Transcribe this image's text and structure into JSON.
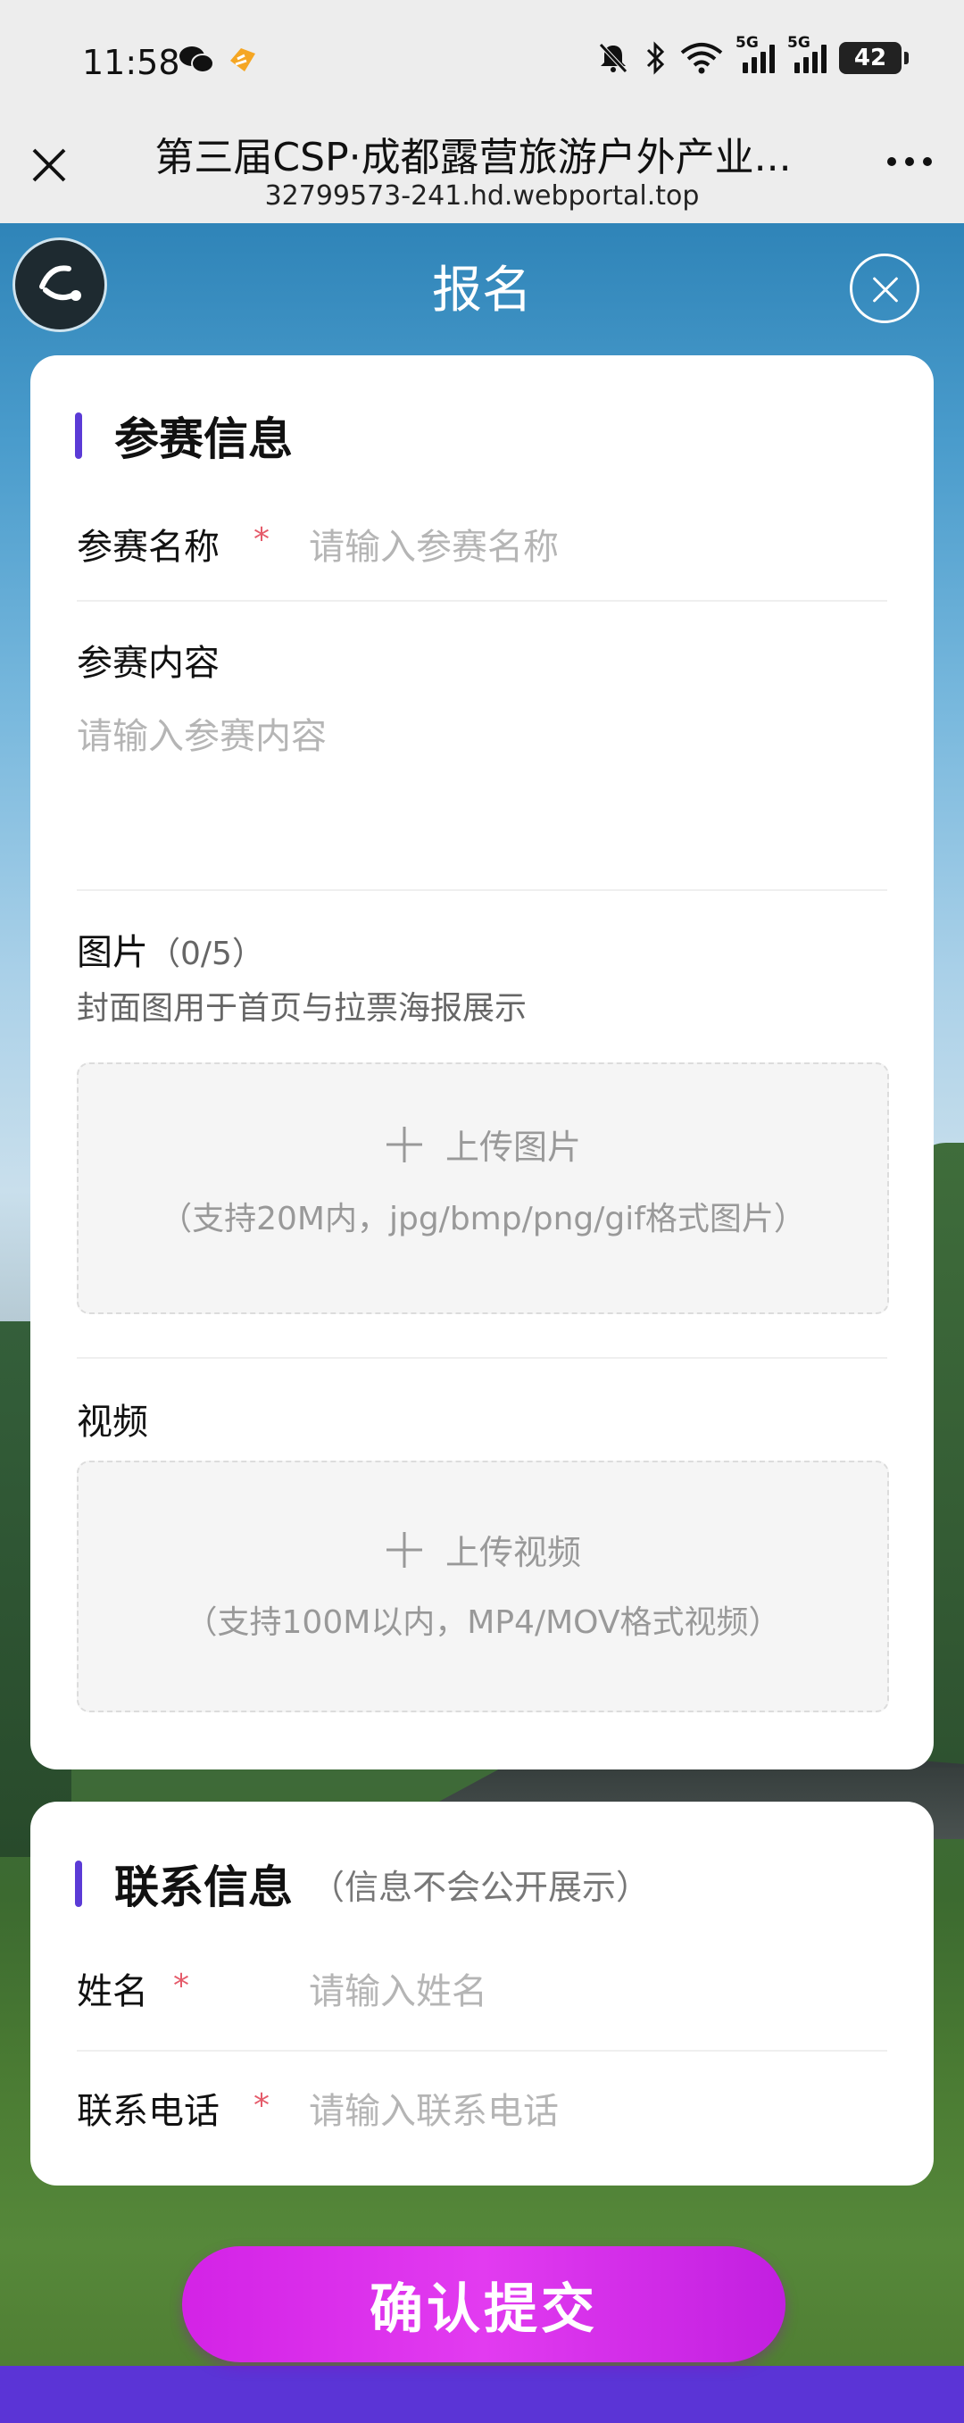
{
  "status_bar": {
    "time": "11:58",
    "battery": "42",
    "network_label": "5G"
  },
  "browser": {
    "title": "第三届CSP·成都露营旅游户外产业...",
    "url": "32799573-241.hd.webportal.top"
  },
  "form": {
    "title": "报名"
  },
  "section_entry": {
    "heading": "参赛信息",
    "name_label": "参赛名称",
    "name_placeholder": "请输入参赛名称",
    "content_label": "参赛内容",
    "content_placeholder": "请输入参赛内容",
    "image_label": "图片",
    "image_count": "（0/5）",
    "image_desc": "封面图用于首页与拉票海报展示",
    "image_upload_label": "上传图片",
    "image_upload_hint": "（支持20M内，jpg/bmp/png/gif格式图片）",
    "video_label": "视频",
    "video_upload_label": "上传视频",
    "video_upload_hint": "（支持100M以内，MP4/MOV格式视频）"
  },
  "section_contact": {
    "heading": "联系信息",
    "note": "（信息不会公开展示）",
    "name_label": "姓名",
    "name_placeholder": "请输入姓名",
    "phone_label": "联系电话",
    "phone_placeholder": "请输入联系电话"
  },
  "required_mark": "*",
  "submit_label": "确认提交",
  "colors": {
    "accent_bar": "#5b3bd6",
    "submit": "#d323e6",
    "required": "#e55b6a"
  }
}
